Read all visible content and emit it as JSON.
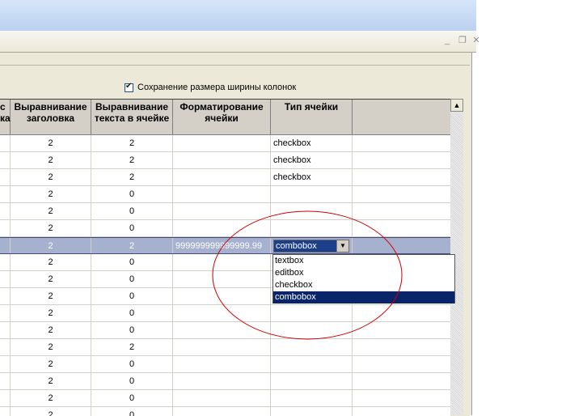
{
  "option": {
    "save_widths_label": "Сохранение размера ширины колонок",
    "checked": true
  },
  "headers": {
    "cut": "с\nка",
    "h1": "Выравнивание заголовка",
    "h2": "Выравнивание текста в ячейке",
    "h3": "Форматирование ячейки",
    "h4": "Тип ячейки"
  },
  "rows": [
    {
      "a": "2",
      "b": "2",
      "fmt": "",
      "type": "checkbox"
    },
    {
      "a": "2",
      "b": "2",
      "fmt": "",
      "type": "checkbox"
    },
    {
      "a": "2",
      "b": "2",
      "fmt": "",
      "type": "checkbox"
    },
    {
      "a": "2",
      "b": "0",
      "fmt": "",
      "type": ""
    },
    {
      "a": "2",
      "b": "0",
      "fmt": "",
      "type": ""
    },
    {
      "a": "2",
      "b": "0",
      "fmt": "",
      "type": ""
    },
    {
      "a": "2",
      "b": "2",
      "fmt": "999999999999999.99",
      "type": ""
    },
    {
      "a": "2",
      "b": "0",
      "fmt": "",
      "type": ""
    },
    {
      "a": "2",
      "b": "0",
      "fmt": "",
      "type": ""
    },
    {
      "a": "2",
      "b": "0",
      "fmt": "",
      "type": ""
    },
    {
      "a": "2",
      "b": "0",
      "fmt": "",
      "type": ""
    },
    {
      "a": "2",
      "b": "0",
      "fmt": "",
      "type": ""
    },
    {
      "a": "2",
      "b": "2",
      "fmt": "",
      "type": ""
    },
    {
      "a": "2",
      "b": "0",
      "fmt": "",
      "type": ""
    },
    {
      "a": "2",
      "b": "0",
      "fmt": "",
      "type": ""
    },
    {
      "a": "2",
      "b": "0",
      "fmt": "",
      "type": ""
    },
    {
      "a": "2",
      "b": "0",
      "fmt": "",
      "type": ""
    }
  ],
  "combo": {
    "value": "combobox",
    "options": [
      "textbox",
      "editbox",
      "checkbox",
      "combobox"
    ],
    "selected_index": 3
  },
  "colors": {
    "selection": "#0a246a",
    "selected_row": "#a6b0cf",
    "annotation": "#cc0000"
  }
}
